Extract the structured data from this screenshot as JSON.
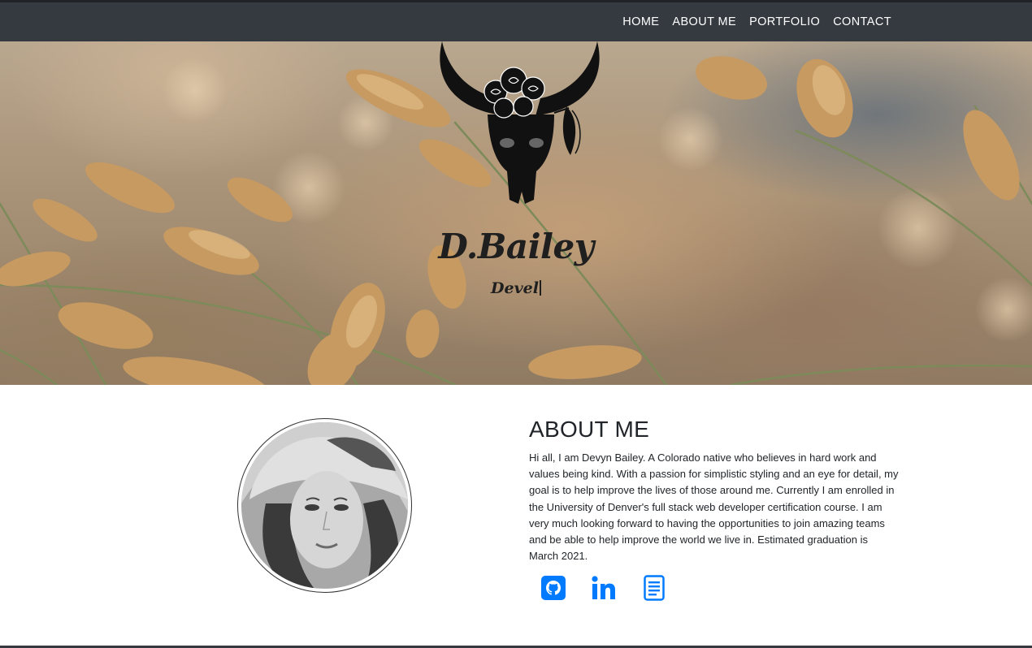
{
  "nav": {
    "links": [
      "HOME",
      "ABOUT ME",
      "PORTFOLIO",
      "CONTACT"
    ]
  },
  "hero": {
    "title": "D.Bailey",
    "subtitle": "Devel",
    "logo_icon": "bull-skull-with-flowers-icon"
  },
  "about": {
    "heading": "ABOUT ME",
    "body": "Hi all, I am Devyn Bailey. A Colorado native who believes in hard work and values being kind. With a passion for simplistic styling and an eye for detail, my goal is to help improve the lives of those around me. Currently I am enrolled in the University of Denver's full stack web developer certification course. I am very much looking forward to having the opportunities to join amazing teams and be able to help improve the world we live in. Estimated graduation is March 2021.",
    "socials": [
      {
        "icon": "github-icon"
      },
      {
        "icon": "linkedin-icon"
      },
      {
        "icon": "resume-document-icon"
      }
    ]
  },
  "colors": {
    "navbar": "#343a40",
    "accent": "#007bff",
    "text": "#212529"
  }
}
